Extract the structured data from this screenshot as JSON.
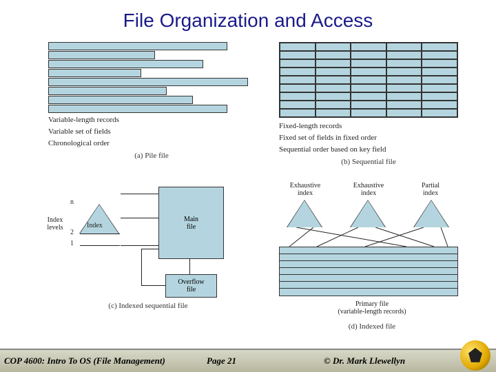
{
  "title": "File Organization and Access",
  "footer": {
    "course": "COP 4600: Intro To OS  (File Management)",
    "page": "Page 21",
    "author": "© Dr. Mark Llewellyn"
  },
  "diagrams": {
    "a": {
      "caption": "(a) Pile file",
      "desc": [
        "Variable-length records",
        "Variable set of fields",
        "Chronological order"
      ],
      "bar_widths": [
        260,
        155,
        225,
        135,
        290,
        172,
        210,
        260
      ]
    },
    "b": {
      "caption": "(b) Sequential file",
      "desc": [
        "Fixed-length records",
        "Fixed set of fields in fixed order",
        "Sequential order based on key field"
      ],
      "rows": 9,
      "cols": 5
    },
    "c": {
      "caption": "(c) Indexed sequential file",
      "labels": {
        "index_levels": "Index\nlevels",
        "n": "n",
        "two": "2",
        "one": "1",
        "index": "Index",
        "main": "Main\nfile",
        "overflow": "Overflow\nfile"
      }
    },
    "d": {
      "caption": "(d) Indexed file",
      "labels": {
        "exhaustive": "Exhaustive\nindex",
        "exhaustive2": "Exhaustive\nindex",
        "partial": "Partial\nindex",
        "primary": "Primary file\n(variable-length records)"
      },
      "table_rows": 7
    }
  }
}
